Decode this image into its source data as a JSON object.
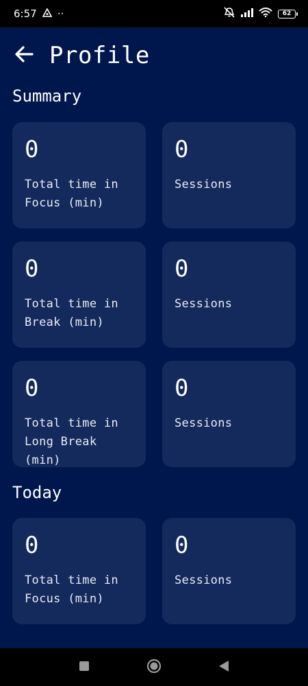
{
  "status_bar": {
    "time": "6:57",
    "dots": "··",
    "battery": "62"
  },
  "header": {
    "title": "Profile"
  },
  "sections": {
    "summary": {
      "title": "Summary",
      "cards": [
        {
          "value": "0",
          "label": "Total time in\nFocus (min)"
        },
        {
          "value": "0",
          "label": "Sessions"
        },
        {
          "value": "0",
          "label": "Total time in\nBreak (min)"
        },
        {
          "value": "0",
          "label": "Sessions"
        },
        {
          "value": "0",
          "label": "Total time in\nLong Break (min)"
        },
        {
          "value": "0",
          "label": "Sessions"
        }
      ]
    },
    "today": {
      "title": "Today",
      "cards": [
        {
          "value": "0",
          "label": "Total time in\nFocus (min)"
        },
        {
          "value": "0",
          "label": "Sessions"
        }
      ]
    }
  },
  "icons": {
    "back": "arrow-left-icon",
    "nav_recents": "square-icon",
    "nav_home": "circle-icon",
    "nav_back": "triangle-back-icon"
  },
  "colors": {
    "background": "#00174d",
    "card": "#142a5c",
    "text": "#ffffff"
  }
}
